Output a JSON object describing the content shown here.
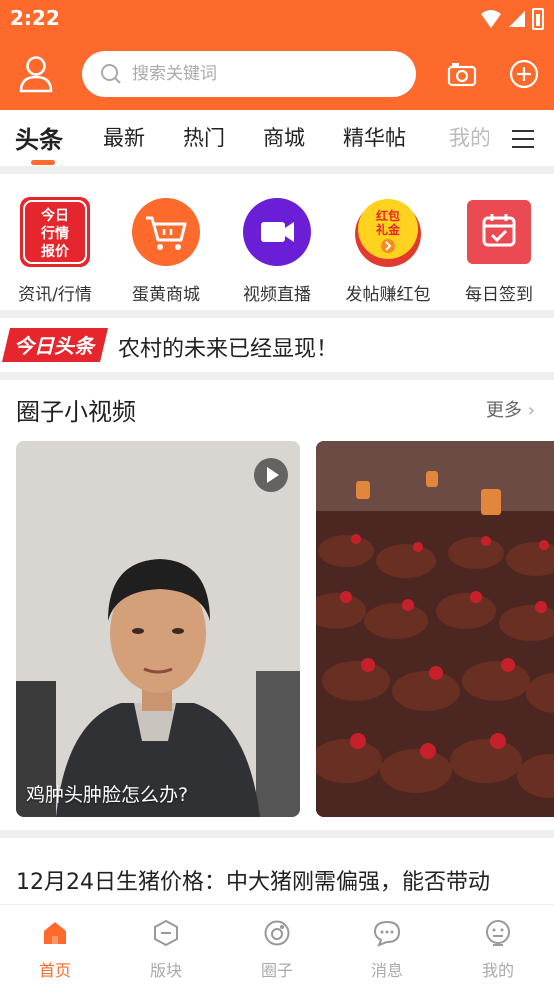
{
  "status": {
    "time": "2:22"
  },
  "search": {
    "placeholder": "搜索关键词"
  },
  "tabs": [
    {
      "label": "头条",
      "active": true
    },
    {
      "label": "最新"
    },
    {
      "label": "热门"
    },
    {
      "label": "商城"
    },
    {
      "label": "精华帖"
    },
    {
      "label": "我的"
    }
  ],
  "shortcuts": [
    {
      "label": "资讯/行情",
      "icon": "market-quote-icon",
      "icon_text": "今日行情报价"
    },
    {
      "label": "蛋黄商城",
      "icon": "cart-icon"
    },
    {
      "label": "视频直播",
      "icon": "video-camera-icon"
    },
    {
      "label": "发帖赚红包",
      "icon": "red-envelope-icon",
      "icon_text": "红包礼金"
    },
    {
      "label": "每日签到",
      "icon": "calendar-check-icon"
    }
  ],
  "headline": {
    "logo_text": "今日头条",
    "text": "农村的未来已经显现！"
  },
  "videos": {
    "title": "圈子小视频",
    "more": "更多",
    "cards": [
      {
        "caption": "鸡肿头肿脸怎么办?"
      },
      {
        "caption": ""
      }
    ]
  },
  "news": {
    "title": "12月24日生猪价格：中大猪刚需偏强，能否带动"
  },
  "bottom_nav": [
    {
      "label": "首页",
      "icon": "home-icon",
      "active": true
    },
    {
      "label": "版块",
      "icon": "hexagon-icon"
    },
    {
      "label": "圈子",
      "icon": "circle-icon"
    },
    {
      "label": "消息",
      "icon": "message-icon"
    },
    {
      "label": "我的",
      "icon": "profile-icon"
    }
  ],
  "colors": {
    "accent": "#fd6a2c",
    "red": "#e5262c",
    "purple": "#6a1fd6"
  }
}
